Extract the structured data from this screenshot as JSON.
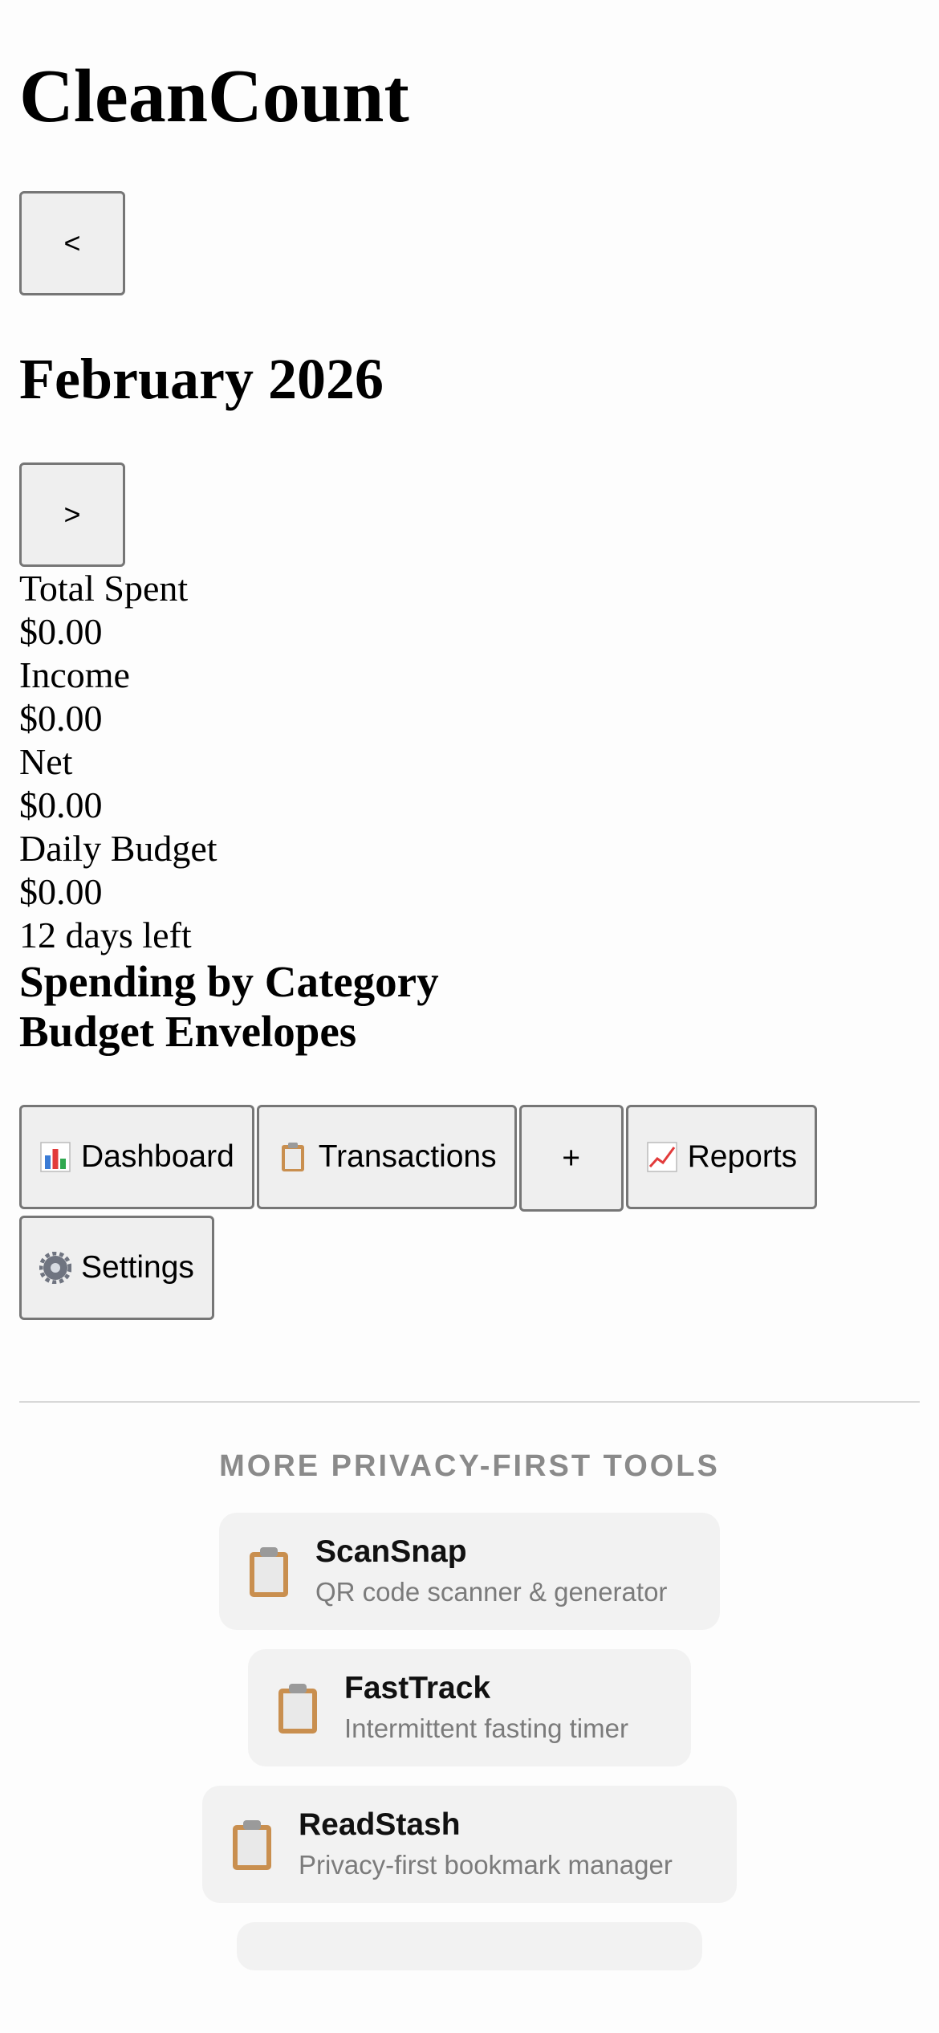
{
  "app": {
    "title": "CleanCount"
  },
  "month_nav": {
    "prev_label": "<",
    "month": "February 2026",
    "next_label": ">"
  },
  "summary": {
    "total_spent_label": "Total Spent",
    "total_spent_value": "$0.00",
    "income_label": "Income",
    "income_value": "$0.00",
    "net_label": "Net",
    "net_value": "$0.00",
    "daily_budget_label": "Daily Budget",
    "daily_budget_value": "$0.00",
    "days_left": "12 days left"
  },
  "sections": {
    "spending_by_category": "Spending by Category",
    "budget_envelopes": "Budget Envelopes"
  },
  "tabs": {
    "dashboard": {
      "label": "Dashboard",
      "icon": "bar-chart-icon"
    },
    "transactions": {
      "label": "Transactions",
      "icon": "clipboard-icon"
    },
    "add": {
      "label": "+"
    },
    "reports": {
      "label": "Reports",
      "icon": "trend-up-icon"
    },
    "settings": {
      "label": "Settings",
      "icon": "gear-icon"
    }
  },
  "more_tools": {
    "heading": "MORE PRIVACY-FIRST TOOLS",
    "items": [
      {
        "name": "ScanSnap",
        "desc": "QR code scanner & generator",
        "icon": "clipboard-icon"
      },
      {
        "name": "FastTrack",
        "desc": "Intermittent fasting timer",
        "icon": "clipboard-icon"
      },
      {
        "name": "ReadStash",
        "desc": "Privacy-first bookmark manager",
        "icon": "clipboard-icon"
      }
    ]
  }
}
